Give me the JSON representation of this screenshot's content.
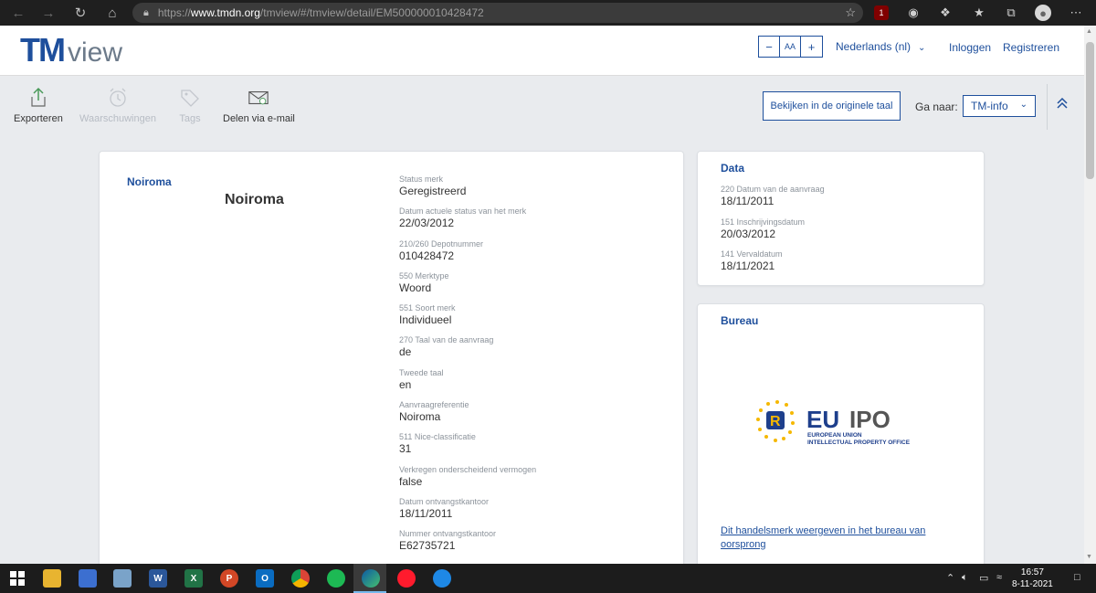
{
  "browser": {
    "url_prefix": "https://",
    "url_domain": "www.tmdn.org",
    "url_path": "/tmview/#/tmview/detail/EM500000010428472",
    "ublock_count": "1"
  },
  "header": {
    "logo_tm": "TM",
    "logo_view": "view",
    "font_minus": "−",
    "font_aa": "AA",
    "font_plus": "+",
    "language": "Nederlands (nl)",
    "login": "Inloggen",
    "register": "Registreren"
  },
  "toolbar": {
    "export": "Exporteren",
    "alerts": "Waarschuwingen",
    "tags": "Tags",
    "share": "Delen via e-mail",
    "original_language": "Bekijken in de originele taal",
    "goto_label": "Ga naar:",
    "goto_value": "TM-info"
  },
  "mark": {
    "side_name": "Noiroma",
    "name": "Noiroma",
    "fields": [
      {
        "label": "Status merk",
        "value": "Geregistreerd"
      },
      {
        "label": "Datum actuele status van het merk",
        "value": "22/03/2012"
      },
      {
        "label": "210/260 Depotnummer",
        "value": "010428472"
      },
      {
        "label": "550 Merktype",
        "value": "Woord"
      },
      {
        "label": "551 Soort merk",
        "value": "Individueel"
      },
      {
        "label": "270 Taal van de aanvraag",
        "value": "de"
      },
      {
        "label": "Tweede taal",
        "value": "en"
      },
      {
        "label": "Aanvraagreferentie",
        "value": "Noiroma"
      },
      {
        "label": "511 Nice-classificatie",
        "value": "31"
      },
      {
        "label": "Verkregen onderscheidend vermogen",
        "value": "false"
      },
      {
        "label": "Datum ontvangstkantoor",
        "value": "18/11/2011"
      },
      {
        "label": "Nummer ontvangstkantoor",
        "value": "E62735721"
      }
    ]
  },
  "data_card": {
    "title": "Data",
    "fields": [
      {
        "label": "220 Datum van de aanvraag",
        "value": "18/11/2011"
      },
      {
        "label": "151 Inschrijvingsdatum",
        "value": "20/03/2012"
      },
      {
        "label": "141 Vervaldatum",
        "value": "18/11/2021"
      }
    ]
  },
  "bureau_card": {
    "title": "Bureau",
    "logo_eu": "EU",
    "logo_ipo": "IPO",
    "logo_line1": "EUROPEAN UNION",
    "logo_line2": "INTELLECTUAL PROPERTY OFFICE",
    "link": "Dit handelsmerk weergeven in het bureau van oorsprong"
  },
  "taskbar": {
    "time": "16:57",
    "date": "8-11-2021"
  }
}
